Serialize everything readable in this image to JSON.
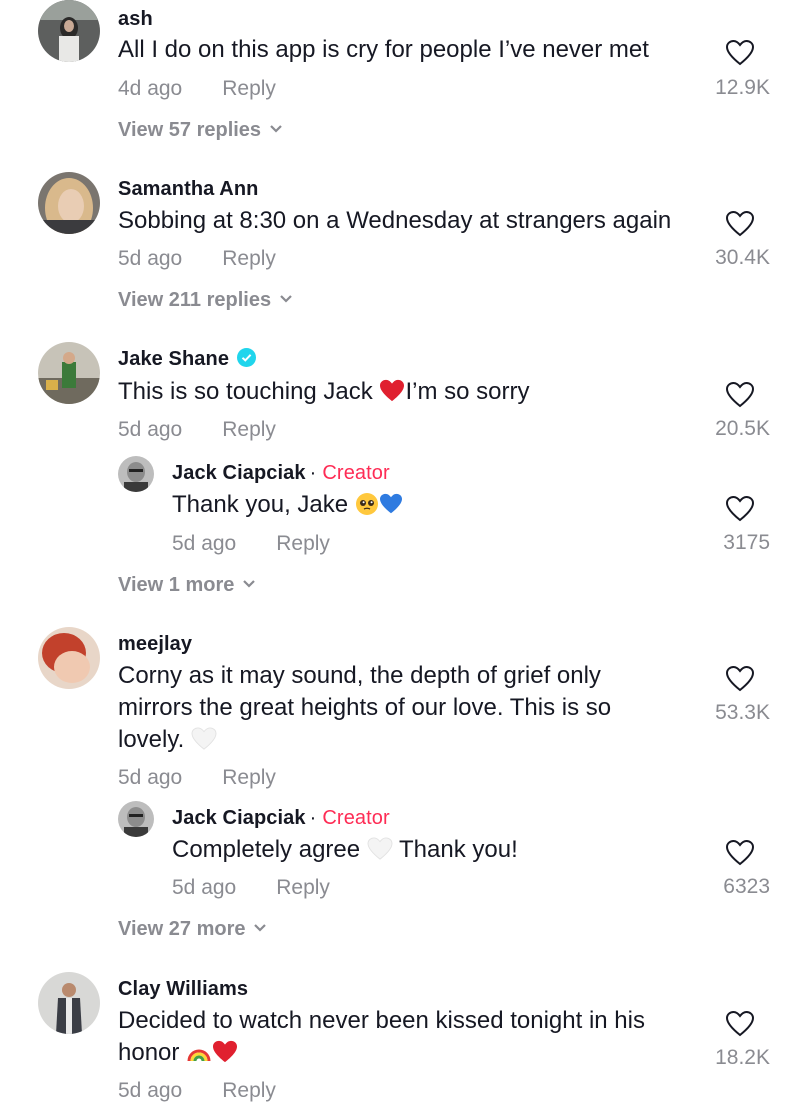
{
  "comments": [
    {
      "username": "ash",
      "text": "All I do on this app is cry for people I’ve never met",
      "time": "4d ago",
      "reply_label": "Reply",
      "likes": "12.9K",
      "view_more": "View 57 replies"
    },
    {
      "username": "Samantha Ann",
      "text": "Sobbing at 8:30 on a Wednesday at strangers again",
      "time": "5d ago",
      "reply_label": "Reply",
      "likes": "30.4K",
      "view_more": "View 211 replies"
    },
    {
      "username": "Jake Shane",
      "verified": true,
      "text_before": "This is so touching Jack ",
      "text_after": "I’m so sorry",
      "time": "5d ago",
      "reply_label": "Reply",
      "likes": "20.5K",
      "reply": {
        "username": "Jack Ciapciak",
        "separator": "·",
        "tag": "Creator",
        "text": "Thank you, Jake ",
        "time": "5d ago",
        "reply_label": "Reply",
        "likes": "3175"
      },
      "view_more": "View 1 more"
    },
    {
      "username": "meejlay",
      "text_lines": [
        "Corny as it may sound, the depth of grief only",
        "mirrors the great heights of our love. This is so",
        "lovely. "
      ],
      "time": "5d ago",
      "reply_label": "Reply",
      "likes": "53.3K",
      "reply": {
        "username": "Jack Ciapciak",
        "separator": "·",
        "tag": "Creator",
        "text_before": "Completely agree ",
        "text_after": " Thank you!",
        "time": "5d ago",
        "reply_label": "Reply",
        "likes": "6323"
      },
      "view_more": "View 27 more"
    },
    {
      "username": "Clay Williams",
      "text_lines": [
        "Decided to watch never been kissed tonight in his",
        "honor "
      ],
      "time": "5d ago",
      "reply_label": "Reply",
      "likes": "18.2K"
    }
  ],
  "icons": {
    "like": "heart-outline-icon",
    "expand": "chevron-down-icon",
    "verified": "verified-badge-icon"
  },
  "colors": {
    "text": "#161823",
    "muted": "#8a8b91",
    "creator": "#fe2c55",
    "verified": "#20d5ec",
    "heart_red": "#e0202f",
    "heart_blue": "#2f7be0"
  }
}
